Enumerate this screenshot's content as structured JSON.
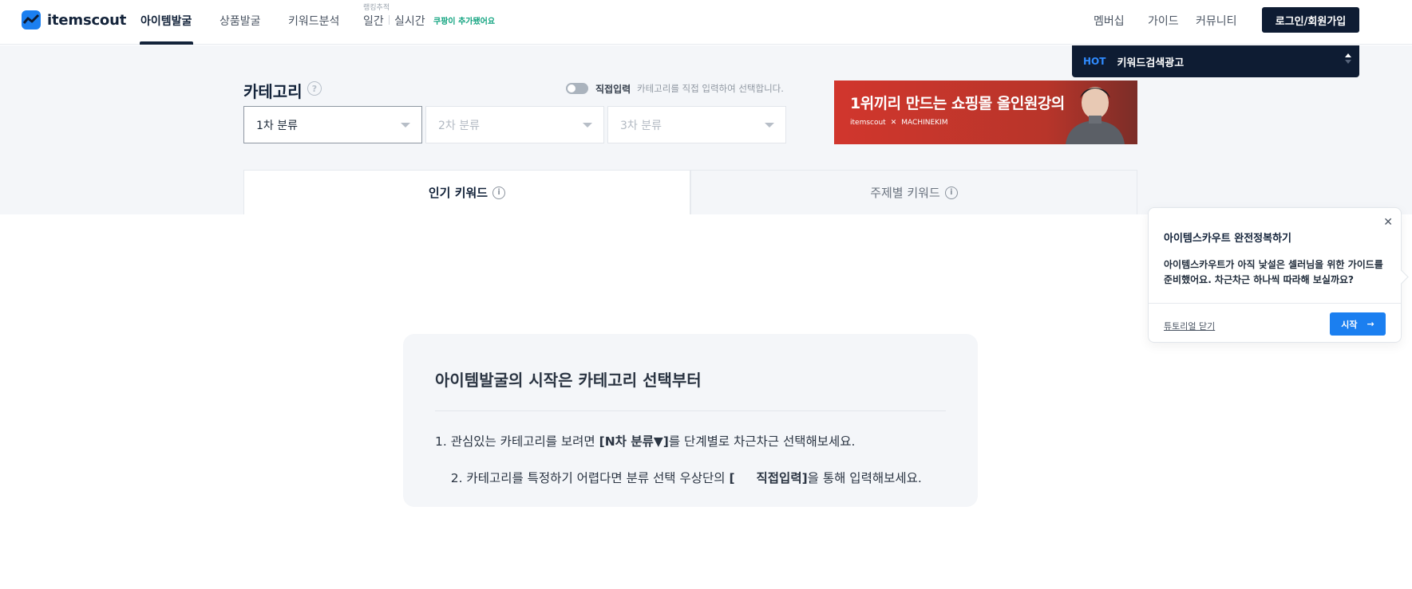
{
  "header": {
    "logo_text": "itemscout",
    "nav": {
      "item_discovery": "아이템발굴",
      "product_discovery": "상품발굴",
      "keyword_analysis": "키워드분석",
      "rank_tracking_label": "랭킹추적",
      "daily": "일간",
      "realtime": "실시간",
      "coupang_note": "쿠팡이 추가됐어요"
    },
    "membership": "멤버십",
    "guide": "가이드",
    "community": "커뮤니티",
    "login": "로그인/회원가입"
  },
  "hot_bar": {
    "tag": "HOT",
    "text": "키워드검색광고"
  },
  "category": {
    "title": "카테고리",
    "help_symbol": "?",
    "direct_input_label": "직접입력",
    "direct_input_desc": "카테고리를 직접 입력하여 선택합니다.",
    "select1": "1차 분류",
    "select2": "2차 분류",
    "select3": "3차 분류"
  },
  "banner": {
    "title": "1위끼리 만드는 쇼핑몰 올인원강의",
    "brand1": "itemscout",
    "cross": "✕",
    "brand2": "MACHINEKIM"
  },
  "tabs": {
    "popular": "인기 키워드",
    "thematic": "주제별 키워드",
    "info_symbol": "i"
  },
  "guide_box": {
    "title": "아이템발굴의 시작은 카테고리 선택부터",
    "line1_pre": "1. 관심있는 카테고리를 보려면 ",
    "line1_bold": "[N차 분류▼]",
    "line1_post": "를 단계별로 차근차근 선택해보세요.",
    "line2_pre": "2. 카테고리를 특정하기 어렵다면 분류 선택 우상단의 ",
    "line2_bold": "[     직접입력]",
    "line2_post": "을 통해 입력해보세요."
  },
  "tutorial": {
    "close": "✕",
    "title": "아이템스카우트 완전정복하기",
    "body": "아이템스카우트가 아직 낯설은 셀러님을 위한 가이드를 준비했어요. 차근차근 하나씩 따라해 보실까요?",
    "skip": "튜토리얼 닫기",
    "start": "시작",
    "start_arrow": "→"
  }
}
